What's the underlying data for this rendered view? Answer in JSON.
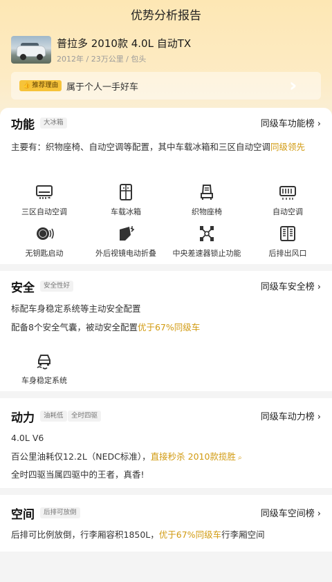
{
  "header": {
    "title": "优势分析报告"
  },
  "car": {
    "name": "普拉多 2010款 4.0L 自动TX",
    "meta": "2012年 / 23万公里 / 包头"
  },
  "reason": {
    "tag": "推荐理由",
    "text": "属于个人一手好车"
  },
  "sections": {
    "function": {
      "title": "功能",
      "badges": [
        "大冰箱"
      ],
      "rank_link": "同级车功能榜",
      "desc_main": "主要有：织物座椅、自动空调等配置，其中车载冰箱和三区自动空调",
      "desc_highlight": "同级领先",
      "features": [
        {
          "label": "三区自动空调",
          "icon": "ac-vent-icon"
        },
        {
          "label": "车载冰箱",
          "icon": "fridge-icon"
        },
        {
          "label": "织物座椅",
          "icon": "seat-icon"
        },
        {
          "label": "自动空调",
          "icon": "auto-ac-icon"
        },
        {
          "label": "无钥匙启动",
          "icon": "keyless-start-icon"
        },
        {
          "label": "外后视镜电动折叠",
          "icon": "mirror-fold-icon"
        },
        {
          "label": "中央差速器锁止功能",
          "icon": "diff-lock-icon"
        },
        {
          "label": "后排出风口",
          "icon": "rear-vent-icon"
        }
      ]
    },
    "safety": {
      "title": "安全",
      "badges": [
        "安全性好"
      ],
      "rank_link": "同级车安全榜",
      "line1": "标配车身稳定系统等主动安全配置",
      "line2_main": "配备8个安全气囊，被动安全配置",
      "line2_highlight": "优于67%同级车",
      "features": [
        {
          "label": "车身稳定系统",
          "icon": "stability-control-icon"
        }
      ]
    },
    "power": {
      "title": "动力",
      "badges": [
        "油耗低",
        "全时四驱"
      ],
      "rank_link": "同级车动力榜",
      "line1": "4.0L V6",
      "line2_main": "百公里油耗仅12.2L（NEDC标准），",
      "line2_highlight": "直接秒杀 2010款揽胜",
      "line3": "全时四驱当属四驱中的王者，真香!"
    },
    "space": {
      "title": "空间",
      "badges": [
        "后排可放倒"
      ],
      "rank_link": "同级车空间榜",
      "line_main": "后排可比例放倒，行李厢容积1850L，",
      "line_highlight": "优于67%同级车",
      "line_tail": "行李厢空间"
    }
  },
  "colors": {
    "accent": "#d19a10",
    "tag_bg": "#f6c33a"
  }
}
